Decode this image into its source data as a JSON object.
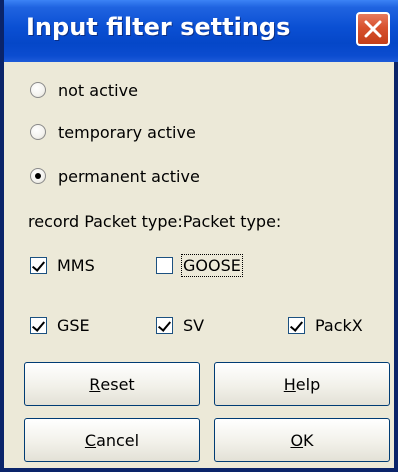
{
  "window": {
    "title": "Input filter settings"
  },
  "mode": {
    "options": [
      {
        "label": "not active",
        "checked": false
      },
      {
        "label": "temporary active",
        "checked": false
      },
      {
        "label": "permanent active",
        "checked": true
      }
    ]
  },
  "packet_types": {
    "label": "record Packet type:Packet type:",
    "items": [
      {
        "label": "MMS",
        "checked": true
      },
      {
        "label": "GOOSE",
        "checked": false
      },
      {
        "label": "GSE",
        "checked": true
      },
      {
        "label": "SV",
        "checked": true
      },
      {
        "label": "PackX",
        "checked": true
      }
    ]
  },
  "buttons": {
    "reset": {
      "accel": "R",
      "rest": "eset"
    },
    "help": {
      "accel": "H",
      "rest": "elp"
    },
    "cancel": {
      "accel": "C",
      "rest": "ancel"
    },
    "ok": {
      "accel": "O",
      "rest": "K"
    }
  }
}
